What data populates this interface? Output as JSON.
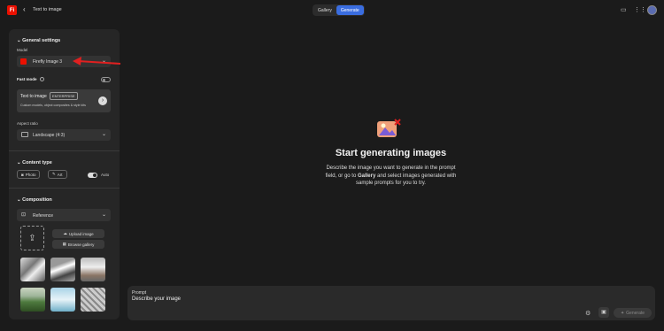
{
  "header": {
    "back_icon": "chevron-left-icon",
    "title": "Text to image",
    "tabs": [
      "Gallery",
      "Generate"
    ],
    "active_tab": "Generate"
  },
  "panel": {
    "general": {
      "heading": "General settings",
      "model_label": "Model",
      "model_value": "Firefly Image 3",
      "fast_mode_label": "Fast mode",
      "card_title": "Text to image",
      "card_badge": "ENTERPRISE",
      "card_desc": "Custom models, object composites & style kits",
      "aspect_label": "Aspect ratio",
      "aspect_value": "Landscape (4:3)"
    },
    "content_type": {
      "heading": "Content type",
      "photo": "Photo",
      "art": "Art",
      "auto": "Auto"
    },
    "composition": {
      "heading": "Composition",
      "reference": "Reference",
      "upload": "Upload image",
      "browse": "Browse gallery"
    }
  },
  "main": {
    "heading": "Start generating images",
    "desc_1": "Describe the image you want to generate in the prompt",
    "desc_2a": "field, or go to ",
    "desc_2b": "Gallery",
    "desc_2c": " and select images generated with",
    "desc_3": "sample prompts for you to try."
  },
  "prompt": {
    "label": "Prompt",
    "placeholder": "Describe your image",
    "generate": "Generate"
  },
  "colors": {
    "accent": "#3a6de0",
    "brand": "#eb1000",
    "arrow": "#e02020"
  }
}
